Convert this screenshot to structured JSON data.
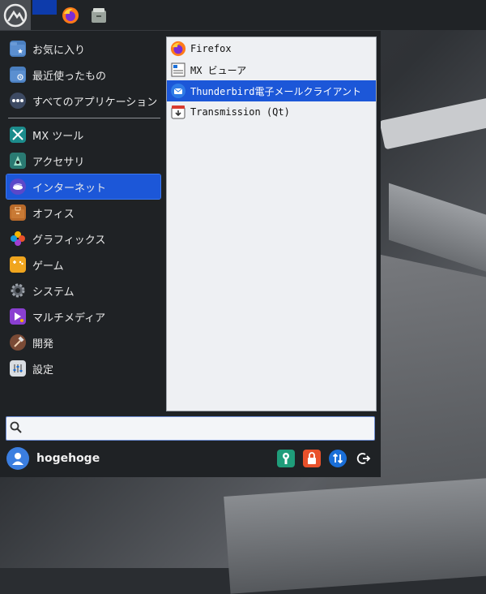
{
  "taskbar": {
    "items": [
      {
        "name": "mx-start-icon"
      },
      {
        "name": "active-window"
      },
      {
        "name": "firefox-icon"
      },
      {
        "name": "file-manager-icon"
      }
    ]
  },
  "menu": {
    "categories": [
      {
        "label": "お気に入り",
        "icon": "favorites-folder-icon"
      },
      {
        "label": "最近使ったもの",
        "icon": "recent-folder-icon"
      },
      {
        "label": "すべてのアプリケーション",
        "icon": "all-apps-icon"
      },
      {
        "label": "MX ツール",
        "icon": "mx-tools-icon"
      },
      {
        "label": "アクセサリ",
        "icon": "accessories-icon"
      },
      {
        "label": "インターネット",
        "icon": "internet-icon"
      },
      {
        "label": "オフィス",
        "icon": "office-icon"
      },
      {
        "label": "グラフィックス",
        "icon": "graphics-icon"
      },
      {
        "label": "ゲーム",
        "icon": "games-icon"
      },
      {
        "label": "システム",
        "icon": "system-gear-icon"
      },
      {
        "label": "マルチメディア",
        "icon": "multimedia-icon"
      },
      {
        "label": "開発",
        "icon": "development-hammer-icon"
      },
      {
        "label": "設定",
        "icon": "settings-icon"
      }
    ],
    "selected_category": "インターネット",
    "apps": [
      {
        "label": "Firefox",
        "icon": "firefox-icon"
      },
      {
        "label": "MX ビューア",
        "icon": "mx-viewer-icon"
      },
      {
        "label": "Thunderbird電子メールクライアント",
        "icon": "thunderbird-icon"
      },
      {
        "label": "Transmission (Qt)",
        "icon": "transmission-icon"
      }
    ],
    "selected_app": "Thunderbird電子メールクライアント",
    "search": {
      "value": "",
      "placeholder": ""
    },
    "user": {
      "name": "hogehoge"
    },
    "actions": [
      {
        "name": "settings-wrench-icon",
        "color": "#1f9d7a"
      },
      {
        "name": "lock-icon",
        "color": "#e8512b"
      },
      {
        "name": "switch-user-icon",
        "color": "#1a6fd8"
      },
      {
        "name": "logout-icon",
        "color": "#2a2d31"
      }
    ]
  },
  "colors": {
    "accent": "#1c57d8",
    "menu_bg": "#1f2225",
    "app_list_bg": "#eef0f3"
  }
}
